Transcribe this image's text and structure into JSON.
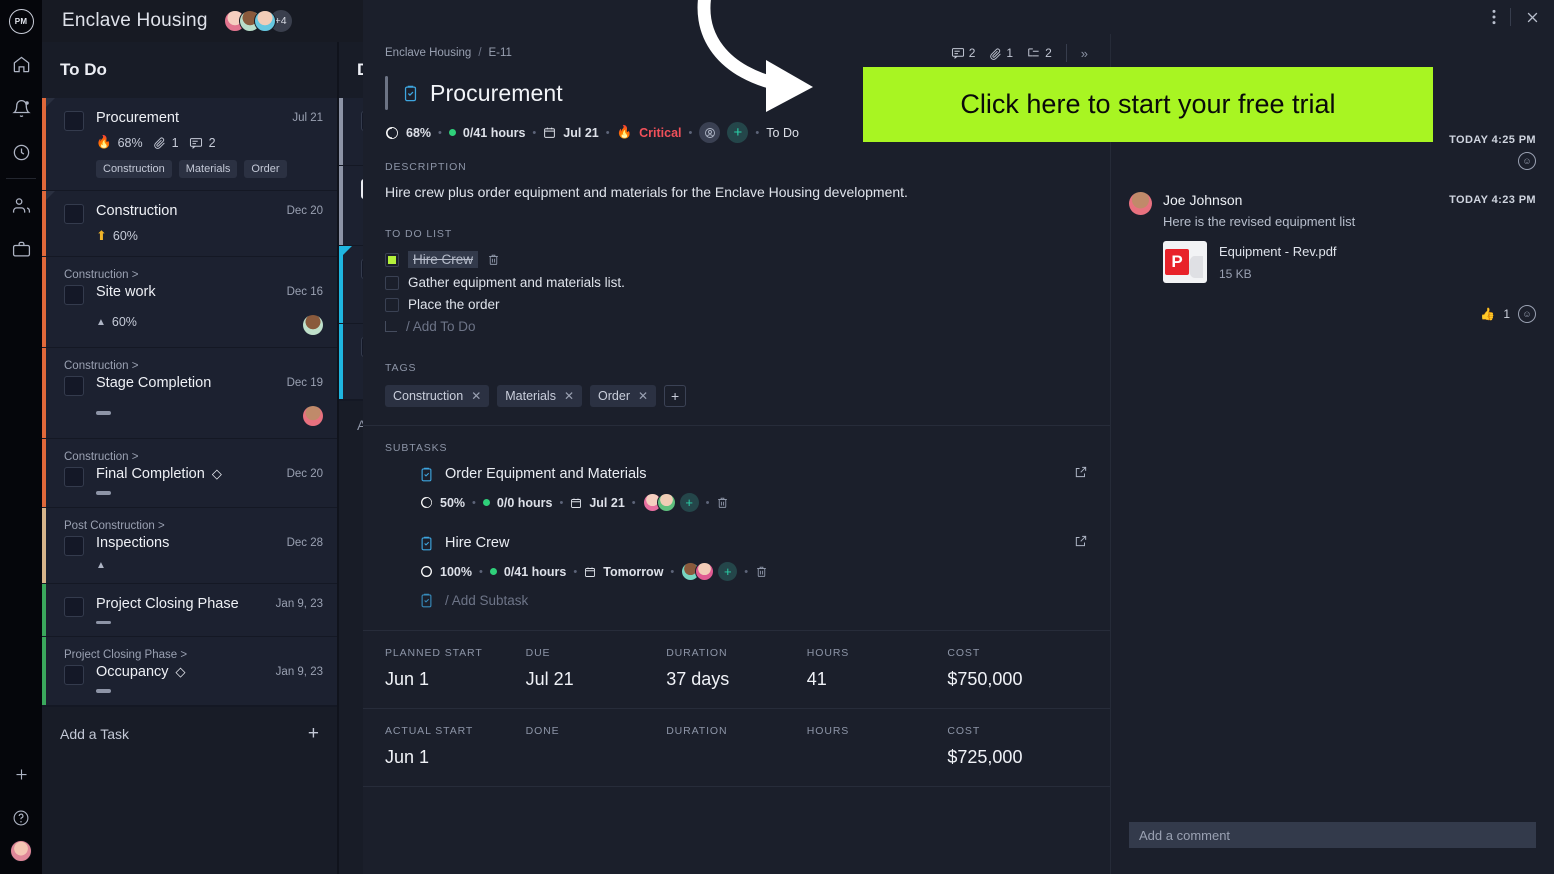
{
  "colors": {
    "accent_cta": "#a8f522",
    "critical": "#f0505a",
    "ok_green": "#2fd07a",
    "panel": "#1b1f2b"
  },
  "rail": {
    "logo": "PM",
    "items": [
      {
        "name": "home-icon"
      },
      {
        "name": "notifications-icon"
      },
      {
        "name": "time-icon"
      },
      {
        "name": "people-icon"
      },
      {
        "name": "portfolio-icon"
      }
    ],
    "bottom": [
      {
        "name": "add-icon",
        "label": "+"
      },
      {
        "name": "help-icon",
        "label": "?"
      }
    ]
  },
  "topbar": {
    "project_title": "Enclave Housing",
    "avatars_overflow": "+4"
  },
  "board": {
    "columns": [
      {
        "title": "To Do",
        "add_label": "Add a Task",
        "add_plus": "+"
      },
      {
        "title": "D"
      }
    ],
    "cards": [
      {
        "parent": "",
        "title": "Procurement",
        "date": "Jul 21",
        "progress": "68%",
        "progress_icon": "fire-icon",
        "attachments": "1",
        "comments": "2",
        "tags": [
          "Construction",
          "Materials",
          "Order"
        ],
        "accent": "#e0683a"
      },
      {
        "parent": "",
        "title": "Construction",
        "date": "Dec 20",
        "progress": "60%",
        "progress_icon": "up-arrow-icon",
        "accent": "#e0683a"
      },
      {
        "parent": "Construction >",
        "title": "Site work",
        "date": "Dec 16",
        "progress": "60%",
        "progress_icon": "triangle-up-icon",
        "accent": "#e0683a"
      },
      {
        "parent": "Construction >",
        "title": "Stage Completion",
        "date": "Dec 19",
        "progress": "",
        "progress_icon": "dash-icon",
        "accent": "#e0683a"
      },
      {
        "parent": "Construction >",
        "title": "Final Completion",
        "milestone": "◇",
        "date": "Dec 20",
        "progress": "",
        "progress_icon": "dash-icon",
        "accent": "#e0683a"
      },
      {
        "parent": "Post Construction >",
        "title": "Inspections",
        "date": "Dec 28",
        "progress": "",
        "progress_icon": "triangle-up-icon",
        "accent": "#d6b48a"
      },
      {
        "parent": "",
        "title": "Project Closing Phase",
        "date": "Jan 9, 23",
        "progress": "",
        "progress_icon": "dash-icon",
        "accent": "#3aa85c"
      },
      {
        "parent": "Project Closing Phase >",
        "title": "Occupancy",
        "milestone": "◇",
        "date": "Jan 9, 23",
        "progress": "",
        "progress_icon": "dash-icon",
        "accent": "#3aa85c"
      }
    ]
  },
  "detail": {
    "window": {
      "more_icon": "kebab-menu-icon",
      "close_icon": "close-icon"
    },
    "breadcrumb": {
      "project": "Enclave Housing",
      "separator": "/",
      "id": "E-11"
    },
    "counts": {
      "comments": "2",
      "attachments": "1",
      "subtasks": "2",
      "expand": "»"
    },
    "title": "Procurement",
    "title_icon": "task-clipboard-icon",
    "status": {
      "progress": "68%",
      "hours": "0/41 hours",
      "due": "Jul 21",
      "priority": "Critical",
      "state": "To Do",
      "assign_icon": "assignee-avatar-icon",
      "add_icon": "add-assignee-icon"
    },
    "description": {
      "label": "DESCRIPTION",
      "text": "Hire crew plus order equipment and materials for the Enclave Housing development."
    },
    "todo": {
      "label": "TO DO LIST",
      "items": [
        {
          "text": "Hire Crew",
          "done": true
        },
        {
          "text": "Gather equipment and materials list.",
          "done": false
        },
        {
          "text": "Place the order",
          "done": false
        }
      ],
      "add_placeholder": "/ Add To Do"
    },
    "tags": {
      "label": "TAGS",
      "items": [
        "Construction",
        "Materials",
        "Order"
      ],
      "add": "+"
    },
    "subtasks": {
      "label": "SUBTASKS",
      "items": [
        {
          "title": "Order Equipment and Materials",
          "progress": "50%",
          "hours": "0/0 hours",
          "due": "Jul 21"
        },
        {
          "title": "Hire Crew",
          "progress": "100%",
          "hours": "0/41 hours",
          "due": "Tomorrow"
        }
      ],
      "add_placeholder": "/ Add Subtask"
    },
    "facts": [
      [
        {
          "label": "PLANNED START",
          "value": "Jun 1"
        },
        {
          "label": "DUE",
          "value": "Jul 21"
        },
        {
          "label": "DURATION",
          "value": "37 days"
        },
        {
          "label": "HOURS",
          "value": "41"
        },
        {
          "label": "COST",
          "value": "$750,000"
        }
      ],
      [
        {
          "label": "ACTUAL START",
          "value": "Jun 1"
        },
        {
          "label": "DONE",
          "value": ""
        },
        {
          "label": "DURATION",
          "value": ""
        },
        {
          "label": "HOURS",
          "value": ""
        },
        {
          "label": "COST",
          "value": "$725,000"
        }
      ]
    ]
  },
  "comments": {
    "top_timestamp": "TODAY 4:25 PM",
    "entry": {
      "author": "Joe Johnson",
      "timestamp": "TODAY 4:23 PM",
      "text": "Here is the revised equipment list",
      "attachment": {
        "name": "Equipment - Rev.pdf",
        "size": "15 KB",
        "icon": "pdf-file-icon"
      },
      "reaction_emoji": "👍",
      "reaction_count": "1"
    },
    "input_placeholder": "Add a comment"
  },
  "cta": {
    "label": "Click here to start your free trial"
  }
}
